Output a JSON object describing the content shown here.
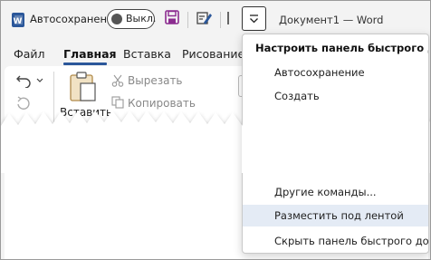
{
  "app": {
    "autosave_label": "Автосохранение",
    "autosave_state": "Выкл.",
    "document_title": "Документ1 — Word"
  },
  "tabs": [
    {
      "label": "Файл"
    },
    {
      "label": "Главная"
    },
    {
      "label": "Вставка"
    },
    {
      "label": "Рисование"
    }
  ],
  "ribbon": {
    "cut_label": "Вырезать",
    "copy_label": "Копировать",
    "paste_label": "Вставить"
  },
  "qat_menu": {
    "title": "Настроить панель быстрого доступа",
    "items": [
      {
        "label": "Автосохранение"
      },
      {
        "label": "Создать"
      },
      {
        "label": "Другие команды..."
      },
      {
        "label": "Разместить под лентой"
      },
      {
        "label": "Скрыть панель быстрого доступа"
      }
    ]
  },
  "colors": {
    "accent": "#2b579a",
    "save_icon": "#8b2b8f",
    "highlight": "#e4ebf5"
  }
}
